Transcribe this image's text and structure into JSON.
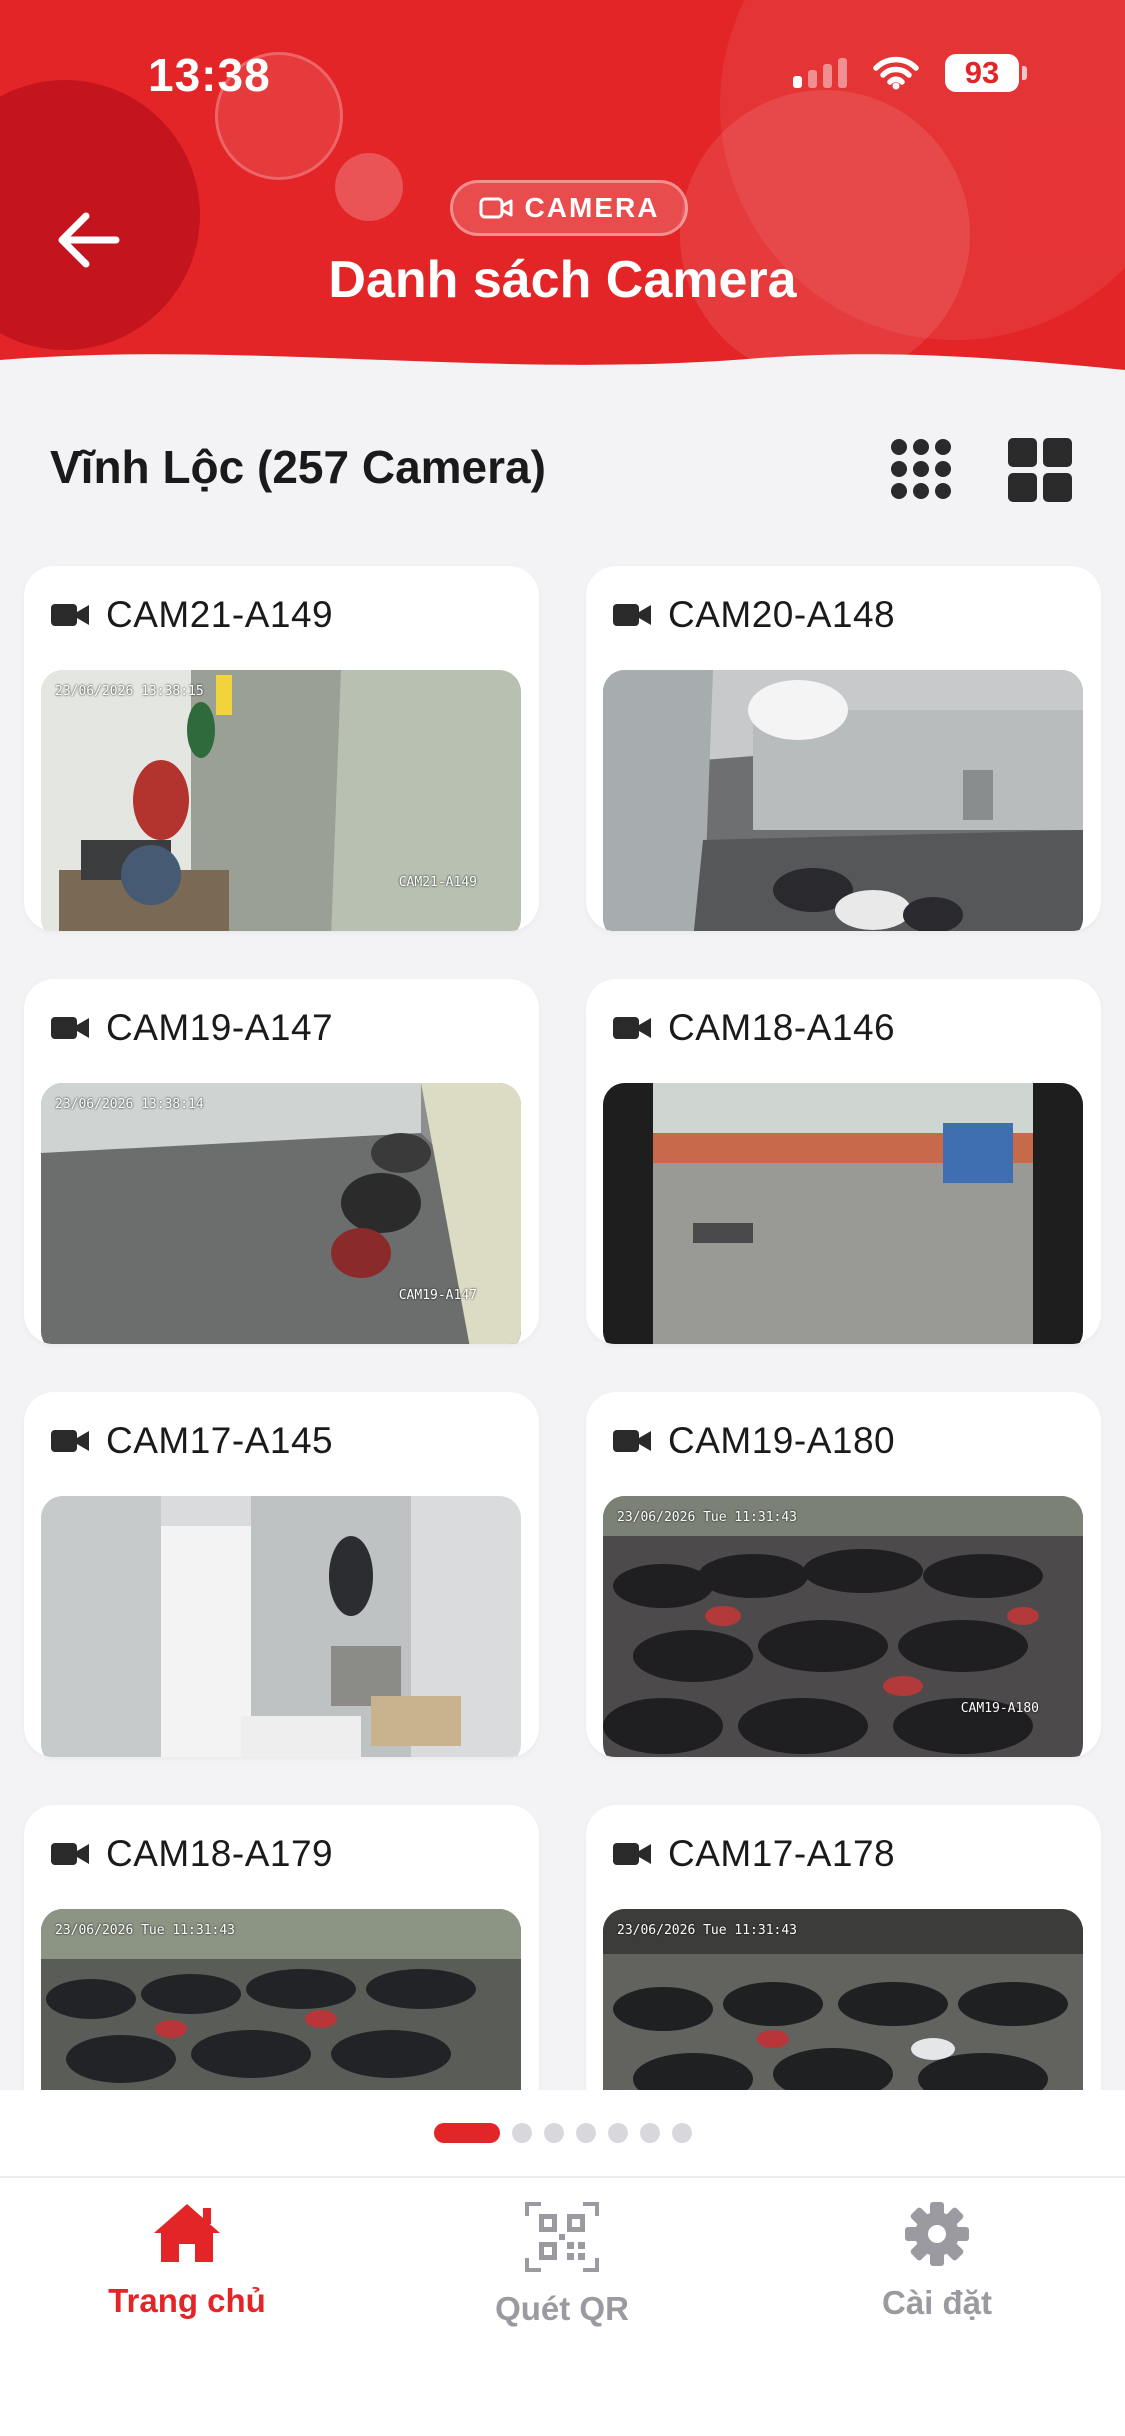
{
  "status_bar": {
    "time": "13:38",
    "battery": "93"
  },
  "header": {
    "badge": "CAMERA",
    "title": "Danh sách Camera"
  },
  "section": {
    "title": "Vĩnh Lộc (257 Camera)"
  },
  "cameras": [
    {
      "name": "CAM21-A149",
      "stamp": "23/06/2026 13:38:15",
      "tag": "CAM21-A149"
    },
    {
      "name": "CAM20-A148"
    },
    {
      "name": "CAM19-A147",
      "stamp": "23/06/2026 13:38:14",
      "tag": "CAM19-A147"
    },
    {
      "name": "CAM18-A146"
    },
    {
      "name": "CAM17-A145"
    },
    {
      "name": "CAM19-A180",
      "stamp": "23/06/2026 Tue 11:31:43",
      "tag": "CAM19-A180"
    },
    {
      "name": "CAM18-A179",
      "stamp": "23/06/2026 Tue 11:31:43"
    },
    {
      "name": "CAM17-A178",
      "stamp": "23/06/2026 Tue 11:31:43"
    }
  ],
  "pager": {
    "pages": 7,
    "active": 0
  },
  "tabs": [
    {
      "label": "Trang chủ",
      "icon": "home-icon",
      "active": true
    },
    {
      "label": "Quét QR",
      "icon": "qr-code-icon",
      "active": false
    },
    {
      "label": "Cài đặt",
      "icon": "gear-icon",
      "active": false
    }
  ],
  "colors": {
    "primary": "#e42527",
    "background": "#f3f3f6",
    "inactive": "#9a9aa0"
  }
}
